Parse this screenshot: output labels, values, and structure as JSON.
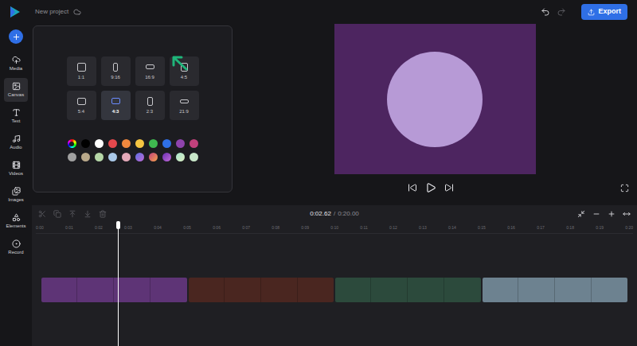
{
  "topbar": {
    "project_title": "New project",
    "export_label": "Export"
  },
  "sidebar": {
    "items": [
      {
        "label": "Media",
        "kind": "media",
        "selected": false
      },
      {
        "label": "Canvas",
        "kind": "canvas",
        "selected": true
      },
      {
        "label": "Text",
        "kind": "text",
        "selected": false
      },
      {
        "label": "Audio",
        "kind": "audio",
        "selected": false
      },
      {
        "label": "Videos",
        "kind": "videos",
        "selected": false
      },
      {
        "label": "Images",
        "kind": "images",
        "selected": false
      },
      {
        "label": "Elements",
        "kind": "elements",
        "selected": false
      },
      {
        "label": "Record",
        "kind": "record",
        "selected": false
      }
    ]
  },
  "canvas_panel": {
    "ratios": [
      {
        "label": "1:1",
        "selected": false
      },
      {
        "label": "9:16",
        "selected": false
      },
      {
        "label": "16:9",
        "selected": false
      },
      {
        "label": "4:5",
        "selected": false
      },
      {
        "label": "5:4",
        "selected": false
      },
      {
        "label": "4:3",
        "selected": true
      },
      {
        "label": "2:3",
        "selected": false
      },
      {
        "label": "21:9",
        "selected": false
      }
    ],
    "swatches": [
      {
        "kind": "picker",
        "color": "#ff0000"
      },
      {
        "kind": "solid",
        "color": "#000000"
      },
      {
        "kind": "solid",
        "color": "#ffffff"
      },
      {
        "kind": "solid",
        "color": "#e5484d"
      },
      {
        "kind": "solid",
        "color": "#f0883e"
      },
      {
        "kind": "solid",
        "color": "#f5c542"
      },
      {
        "kind": "solid",
        "color": "#3fb950"
      },
      {
        "kind": "solid",
        "color": "#2f6fe6"
      },
      {
        "kind": "solid",
        "color": "#8e44ad"
      },
      {
        "kind": "solid",
        "color": "#c2417c"
      },
      {
        "kind": "solid",
        "color": "#a0a0a0"
      },
      {
        "kind": "solid",
        "color": "#b8a88a"
      },
      {
        "kind": "solid",
        "color": "#b5d6a7"
      },
      {
        "kind": "solid",
        "color": "#a9c8e8"
      },
      {
        "kind": "solid",
        "color": "#e3a8b8"
      },
      {
        "kind": "gradient",
        "color": "#5b6ee1",
        "color2": "#c06ad6"
      },
      {
        "kind": "gradient",
        "color": "#c2417c",
        "color2": "#f5a34a"
      },
      {
        "kind": "gradient",
        "color": "#6a2fb0",
        "color2": "#c26bd9"
      },
      {
        "kind": "gradient",
        "color": "#a8e6cf",
        "color2": "#dcedc1"
      },
      {
        "kind": "solid",
        "color": "#c8e6c9"
      }
    ]
  },
  "timeline": {
    "current_time": "0:02.62",
    "separator": "/",
    "total_time": "0:20.00",
    "playhead_level": 0.131,
    "tools": [
      {
        "kind": "split",
        "disabled": true
      },
      {
        "kind": "duplicate",
        "disabled": true
      },
      {
        "kind": "move-up",
        "disabled": true
      },
      {
        "kind": "move-down",
        "disabled": true
      },
      {
        "kind": "delete",
        "disabled": true
      }
    ],
    "zoom_tools": [
      {
        "kind": "fit",
        "disabled": false
      },
      {
        "kind": "zoom-out",
        "disabled": false
      },
      {
        "kind": "zoom-in",
        "disabled": false
      },
      {
        "kind": "expand",
        "disabled": false
      }
    ],
    "ruler": [
      "0:00",
      "0:01",
      "0:02",
      "0:03",
      "0:04",
      "0:05",
      "0:06",
      "0:07",
      "0:08",
      "0:09",
      "0:10",
      "0:11",
      "0:12",
      "0:13",
      "0:14",
      "0:15",
      "0:16",
      "0:17",
      "0:18",
      "0:19",
      "0:20"
    ],
    "clips": [
      {
        "color": "#5e3476"
      },
      {
        "color": "#4a2620"
      },
      {
        "color": "#2c4a3c"
      },
      {
        "color": "#6d8290"
      }
    ]
  }
}
